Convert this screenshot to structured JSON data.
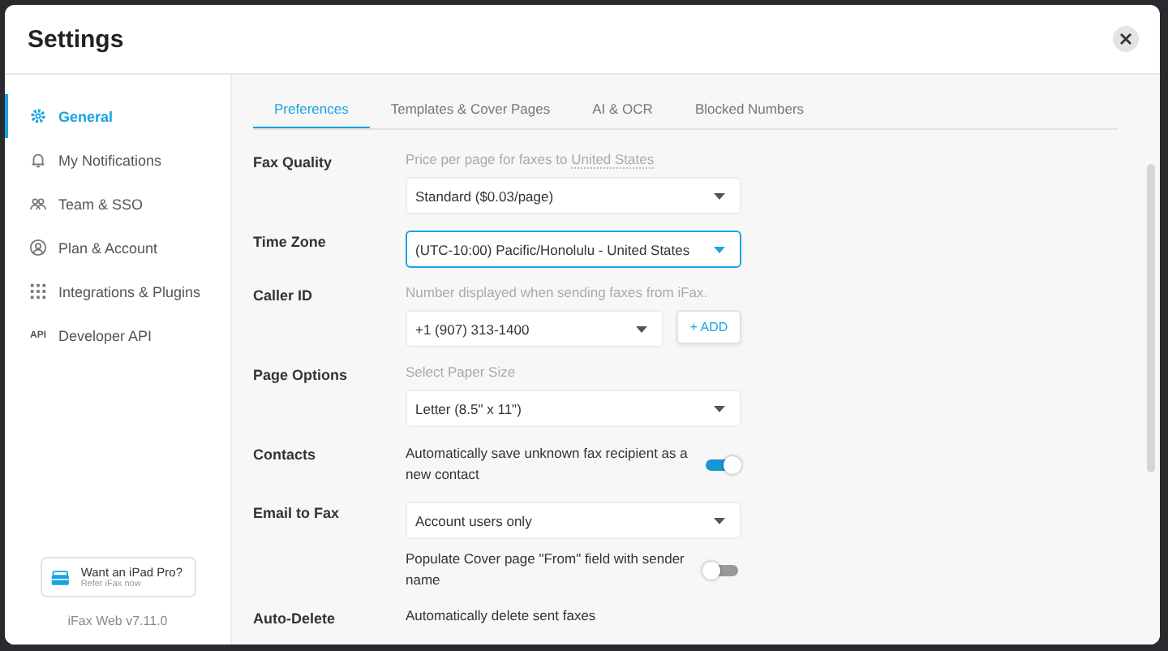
{
  "window": {
    "title": "Settings"
  },
  "sidebar": {
    "items": [
      {
        "label": "General",
        "selected": true
      },
      {
        "label": "My Notifications",
        "selected": false
      },
      {
        "label": "Team & SSO",
        "selected": false
      },
      {
        "label": "Plan & Account",
        "selected": false
      },
      {
        "label": "Integrations & Plugins",
        "selected": false
      },
      {
        "label": "Developer API",
        "selected": false,
        "badge": "API"
      }
    ],
    "promo": {
      "title": "Want an iPad Pro?",
      "subtitle": "Refer iFax now"
    },
    "version": "iFax Web v7.11.0"
  },
  "tabs": [
    {
      "label": "Preferences",
      "selected": true
    },
    {
      "label": "Templates & Cover Pages",
      "selected": false
    },
    {
      "label": "AI & OCR",
      "selected": false
    },
    {
      "label": "Blocked Numbers",
      "selected": false
    }
  ],
  "settings": [
    {
      "label": "Fax Quality",
      "controls": [
        {
          "kind": "hint",
          "text": "Price per page for faxes to",
          "link": "United States"
        },
        {
          "kind": "select",
          "value": "Standard ($0.03/page)",
          "focused": false
        }
      ]
    },
    {
      "label": "Time Zone",
      "controls": [
        {
          "kind": "select",
          "value": "(UTC-10:00) Pacific/Honolulu - United States",
          "focused": true
        }
      ]
    },
    {
      "label": "Caller ID",
      "controls": [
        {
          "kind": "hint",
          "text": "Number displayed when sending faxes from iFax."
        },
        {
          "kind": "select",
          "value": "+1 (907) 313-1400",
          "focused": false,
          "action": "+ ADD"
        }
      ]
    },
    {
      "label": "Page Options",
      "controls": [
        {
          "kind": "hint",
          "text": "Select Paper Size"
        },
        {
          "kind": "select",
          "value": "Letter (8.5\" x 11\")",
          "focused": false
        }
      ]
    },
    {
      "label": "Contacts",
      "controls": [
        {
          "kind": "toggle",
          "text": "Automatically save unknown fax recipient as a new contact",
          "on": true
        }
      ]
    },
    {
      "label": "Email to Fax",
      "controls": [
        {
          "kind": "select",
          "value": "Account users only",
          "focused": false
        },
        {
          "kind": "toggle",
          "text": "Populate Cover page \"From\" field with sender name",
          "on": false
        }
      ]
    },
    {
      "label": "Auto-Delete",
      "controls": [
        {
          "kind": "text",
          "text": "Automatically delete sent faxes"
        }
      ]
    }
  ]
}
